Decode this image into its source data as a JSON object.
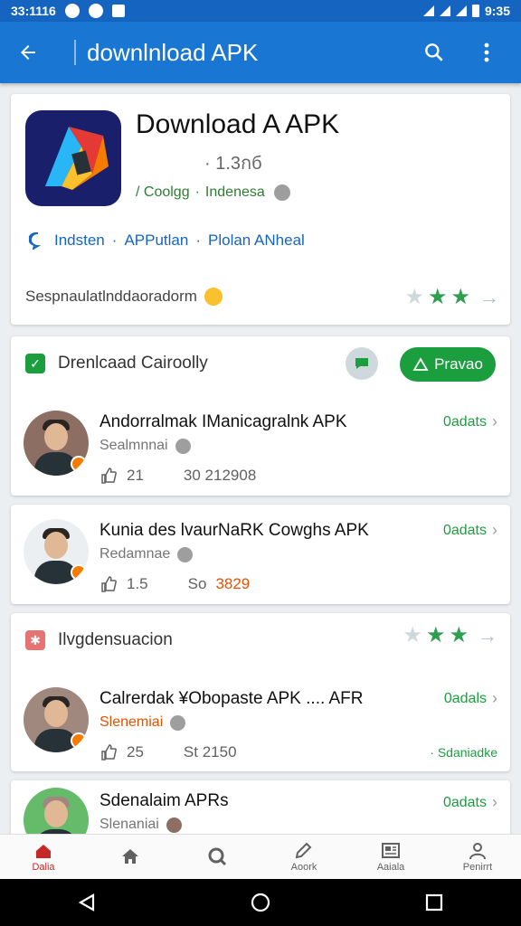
{
  "status": {
    "time_left": "33:1116",
    "time_right": "9:35"
  },
  "app_bar": {
    "title": "downlnload APK"
  },
  "hero": {
    "title": "Download A APK",
    "size": "· 1.3กб",
    "category": "/ Coolgg",
    "region": "Indenesa",
    "link_1": "Indsten",
    "link_2": "APPutlan",
    "link_3": "Plolan ANheal",
    "footer": "Sespnaulatlnddaoradorm",
    "rating": 2
  },
  "section_1": {
    "title": "Drenlcaad Cairoolly",
    "preview_label": "Pravao",
    "items": [
      {
        "title": "Andorralmak IManicagralnk APK",
        "subtitle": "Sealmnnai",
        "likes": "21",
        "stat": "30 212908",
        "stat_orange": "",
        "action": "0adats"
      },
      {
        "title": "Kunia des lvaurNaRK Cowghs APK",
        "subtitle": "Redamnae",
        "likes": "1.5",
        "stat": "So",
        "stat_orange": "3829",
        "action": "0adats"
      }
    ]
  },
  "section_2": {
    "title": "Ilvgdensuacion",
    "rating": 2,
    "items": [
      {
        "title": "Calrerdak ¥Obopaste APK .... AFR",
        "subtitle": "Slenemiai",
        "likes": "25",
        "stat": "St 2150",
        "action": "0adals",
        "tag": "· Sdaniadke"
      },
      {
        "title": "Sdenalaim APRs",
        "subtitle": "Slenaniai",
        "action": "0adats"
      }
    ]
  },
  "bottom_nav": [
    "Dalia",
    "",
    "",
    "Aoork",
    "Aaiala",
    "Penirrt"
  ],
  "colors": {
    "primary": "#1976d2",
    "status": "#1565c0",
    "accent_green": "#1b9e3e",
    "orange": "#e65100"
  }
}
